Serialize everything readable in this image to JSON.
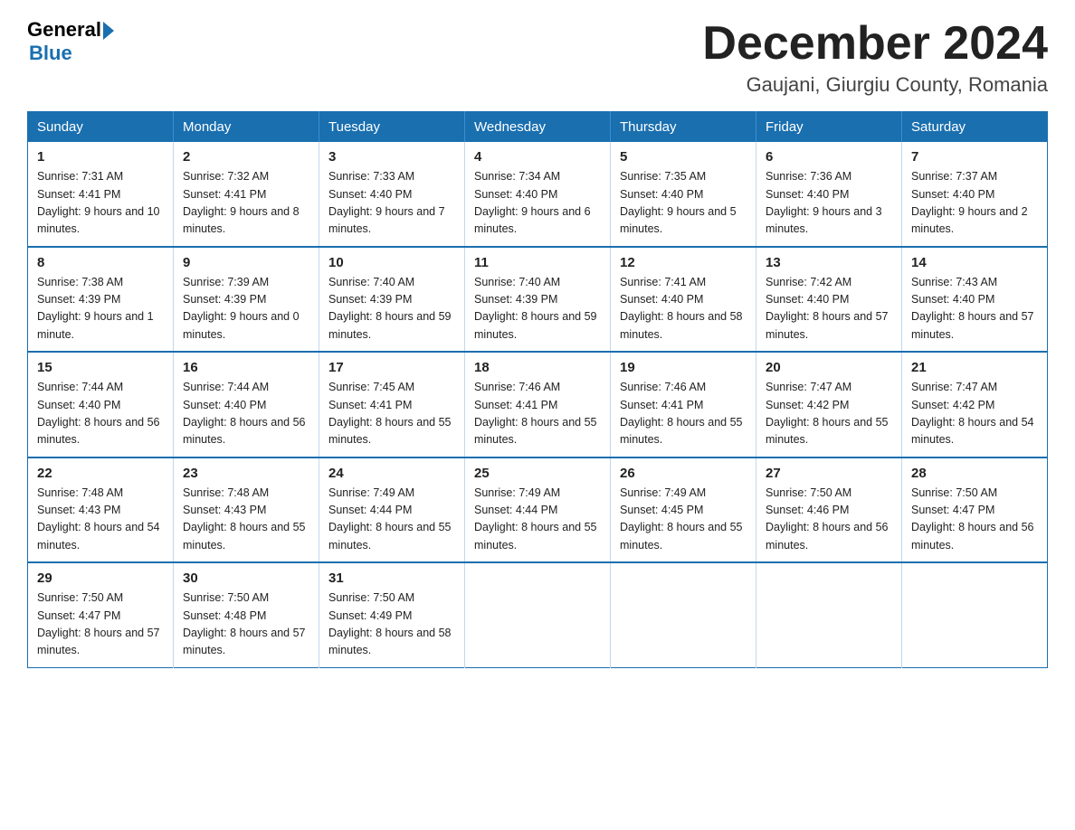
{
  "logo": {
    "general": "General",
    "blue": "Blue"
  },
  "header": {
    "month": "December 2024",
    "location": "Gaujani, Giurgiu County, Romania"
  },
  "days_of_week": [
    "Sunday",
    "Monday",
    "Tuesday",
    "Wednesday",
    "Thursday",
    "Friday",
    "Saturday"
  ],
  "weeks": [
    [
      {
        "day": "1",
        "sunrise": "7:31 AM",
        "sunset": "4:41 PM",
        "daylight": "9 hours and 10 minutes."
      },
      {
        "day": "2",
        "sunrise": "7:32 AM",
        "sunset": "4:41 PM",
        "daylight": "9 hours and 8 minutes."
      },
      {
        "day": "3",
        "sunrise": "7:33 AM",
        "sunset": "4:40 PM",
        "daylight": "9 hours and 7 minutes."
      },
      {
        "day": "4",
        "sunrise": "7:34 AM",
        "sunset": "4:40 PM",
        "daylight": "9 hours and 6 minutes."
      },
      {
        "day": "5",
        "sunrise": "7:35 AM",
        "sunset": "4:40 PM",
        "daylight": "9 hours and 5 minutes."
      },
      {
        "day": "6",
        "sunrise": "7:36 AM",
        "sunset": "4:40 PM",
        "daylight": "9 hours and 3 minutes."
      },
      {
        "day": "7",
        "sunrise": "7:37 AM",
        "sunset": "4:40 PM",
        "daylight": "9 hours and 2 minutes."
      }
    ],
    [
      {
        "day": "8",
        "sunrise": "7:38 AM",
        "sunset": "4:39 PM",
        "daylight": "9 hours and 1 minute."
      },
      {
        "day": "9",
        "sunrise": "7:39 AM",
        "sunset": "4:39 PM",
        "daylight": "9 hours and 0 minutes."
      },
      {
        "day": "10",
        "sunrise": "7:40 AM",
        "sunset": "4:39 PM",
        "daylight": "8 hours and 59 minutes."
      },
      {
        "day": "11",
        "sunrise": "7:40 AM",
        "sunset": "4:39 PM",
        "daylight": "8 hours and 59 minutes."
      },
      {
        "day": "12",
        "sunrise": "7:41 AM",
        "sunset": "4:40 PM",
        "daylight": "8 hours and 58 minutes."
      },
      {
        "day": "13",
        "sunrise": "7:42 AM",
        "sunset": "4:40 PM",
        "daylight": "8 hours and 57 minutes."
      },
      {
        "day": "14",
        "sunrise": "7:43 AM",
        "sunset": "4:40 PM",
        "daylight": "8 hours and 57 minutes."
      }
    ],
    [
      {
        "day": "15",
        "sunrise": "7:44 AM",
        "sunset": "4:40 PM",
        "daylight": "8 hours and 56 minutes."
      },
      {
        "day": "16",
        "sunrise": "7:44 AM",
        "sunset": "4:40 PM",
        "daylight": "8 hours and 56 minutes."
      },
      {
        "day": "17",
        "sunrise": "7:45 AM",
        "sunset": "4:41 PM",
        "daylight": "8 hours and 55 minutes."
      },
      {
        "day": "18",
        "sunrise": "7:46 AM",
        "sunset": "4:41 PM",
        "daylight": "8 hours and 55 minutes."
      },
      {
        "day": "19",
        "sunrise": "7:46 AM",
        "sunset": "4:41 PM",
        "daylight": "8 hours and 55 minutes."
      },
      {
        "day": "20",
        "sunrise": "7:47 AM",
        "sunset": "4:42 PM",
        "daylight": "8 hours and 55 minutes."
      },
      {
        "day": "21",
        "sunrise": "7:47 AM",
        "sunset": "4:42 PM",
        "daylight": "8 hours and 54 minutes."
      }
    ],
    [
      {
        "day": "22",
        "sunrise": "7:48 AM",
        "sunset": "4:43 PM",
        "daylight": "8 hours and 54 minutes."
      },
      {
        "day": "23",
        "sunrise": "7:48 AM",
        "sunset": "4:43 PM",
        "daylight": "8 hours and 55 minutes."
      },
      {
        "day": "24",
        "sunrise": "7:49 AM",
        "sunset": "4:44 PM",
        "daylight": "8 hours and 55 minutes."
      },
      {
        "day": "25",
        "sunrise": "7:49 AM",
        "sunset": "4:44 PM",
        "daylight": "8 hours and 55 minutes."
      },
      {
        "day": "26",
        "sunrise": "7:49 AM",
        "sunset": "4:45 PM",
        "daylight": "8 hours and 55 minutes."
      },
      {
        "day": "27",
        "sunrise": "7:50 AM",
        "sunset": "4:46 PM",
        "daylight": "8 hours and 56 minutes."
      },
      {
        "day": "28",
        "sunrise": "7:50 AM",
        "sunset": "4:47 PM",
        "daylight": "8 hours and 56 minutes."
      }
    ],
    [
      {
        "day": "29",
        "sunrise": "7:50 AM",
        "sunset": "4:47 PM",
        "daylight": "8 hours and 57 minutes."
      },
      {
        "day": "30",
        "sunrise": "7:50 AM",
        "sunset": "4:48 PM",
        "daylight": "8 hours and 57 minutes."
      },
      {
        "day": "31",
        "sunrise": "7:50 AM",
        "sunset": "4:49 PM",
        "daylight": "8 hours and 58 minutes."
      },
      null,
      null,
      null,
      null
    ]
  ]
}
